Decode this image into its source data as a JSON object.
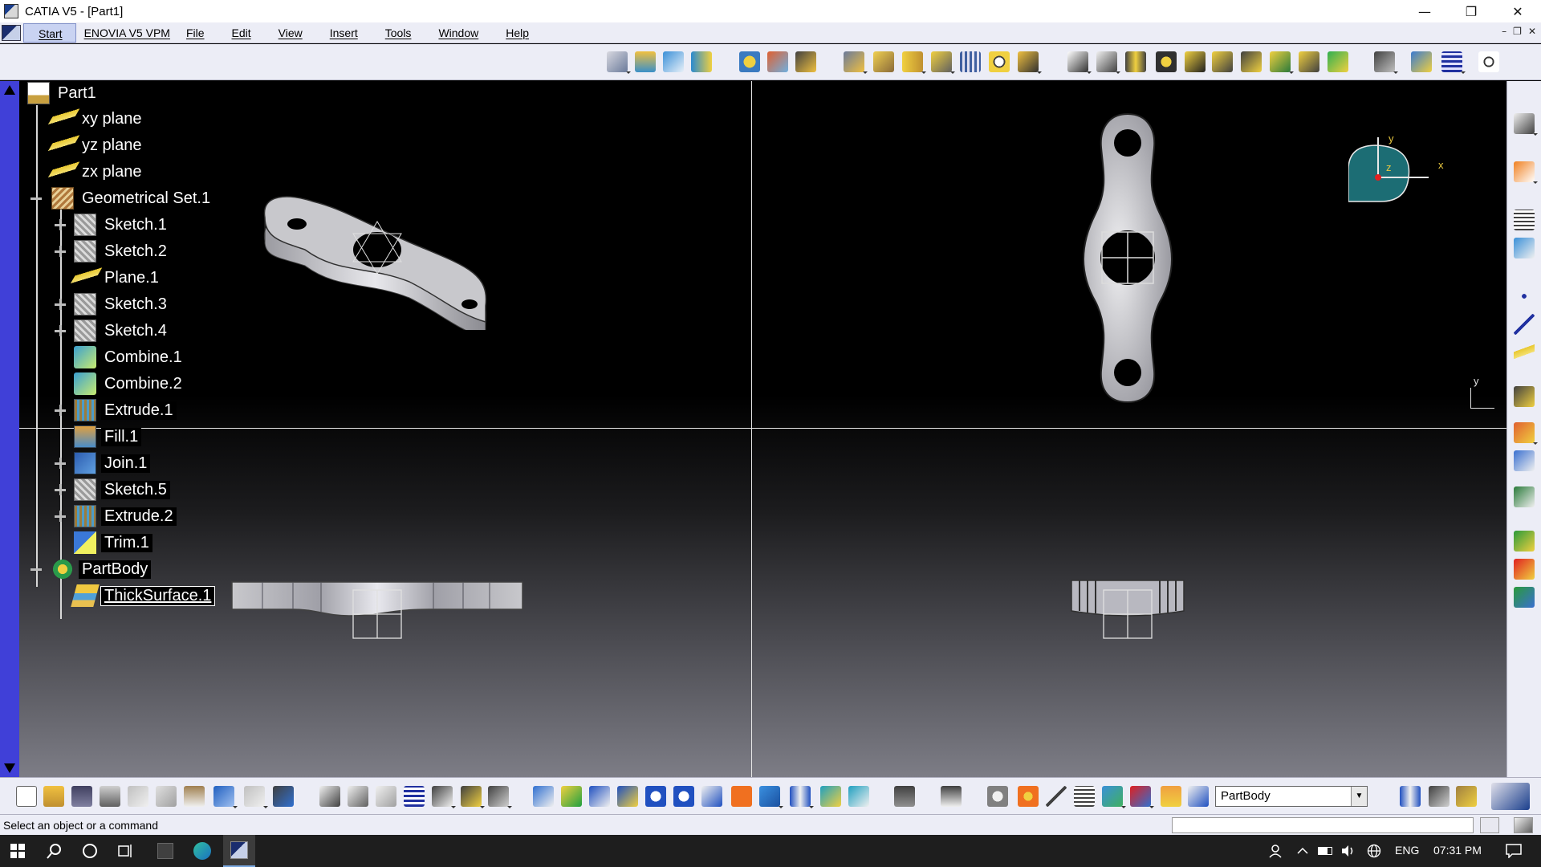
{
  "window": {
    "title": "CATIA V5 - [Part1]",
    "minimize": "—",
    "restore": "❐",
    "close": "✕"
  },
  "menu": {
    "items": [
      "Start",
      "ENOVIA V5 VPM",
      "File",
      "Edit",
      "View",
      "Insert",
      "Tools",
      "Window",
      "Help"
    ],
    "mdi": {
      "minimize": "–",
      "restore": "❐",
      "close": "✕"
    }
  },
  "tree": {
    "root": "Part1",
    "planes": [
      "xy plane",
      "yz plane",
      "zx plane"
    ],
    "geoset": "Geometrical Set.1",
    "geoset_children": [
      {
        "label": "Sketch.1",
        "icon": "sketch-icon",
        "expandable": true
      },
      {
        "label": "Sketch.2",
        "icon": "sketch-icon",
        "expandable": true
      },
      {
        "label": "Plane.1",
        "icon": "plane-icon",
        "expandable": false
      },
      {
        "label": "Sketch.3",
        "icon": "sketch-icon",
        "expandable": true
      },
      {
        "label": "Sketch.4",
        "icon": "sketch-icon",
        "expandable": true
      },
      {
        "label": "Combine.1",
        "icon": "combine-icon",
        "expandable": false
      },
      {
        "label": "Combine.2",
        "icon": "combine-icon",
        "expandable": false
      },
      {
        "label": "Extrude.1",
        "icon": "extrude-icon",
        "expandable": true
      },
      {
        "label": "Fill.1",
        "icon": "fill-icon",
        "expandable": false
      },
      {
        "label": "Join.1",
        "icon": "join-icon",
        "expandable": true
      },
      {
        "label": "Sketch.5",
        "icon": "sketch-icon",
        "expandable": true
      },
      {
        "label": "Extrude.2",
        "icon": "extrude-icon",
        "expandable": true
      },
      {
        "label": "Trim.1",
        "icon": "trim-icon",
        "expandable": false
      }
    ],
    "body": "PartBody",
    "body_children": [
      "ThickSurface.1"
    ]
  },
  "compass": {
    "x_label": "x",
    "y_label": "y",
    "z_label": "z"
  },
  "mini_axis": {
    "y_label": "y"
  },
  "bottom": {
    "current_body": "PartBody"
  },
  "status": {
    "message": "Select an object or a command"
  },
  "taskbar": {
    "language": "ENG",
    "time": "07:31 PM"
  },
  "colors": {
    "accent": "#4040d8",
    "viewport_bg": "#000000",
    "toolbar_bg": "#ecedf6",
    "tree_text": "#ffffff",
    "compass_fill": "#1c6d74"
  }
}
